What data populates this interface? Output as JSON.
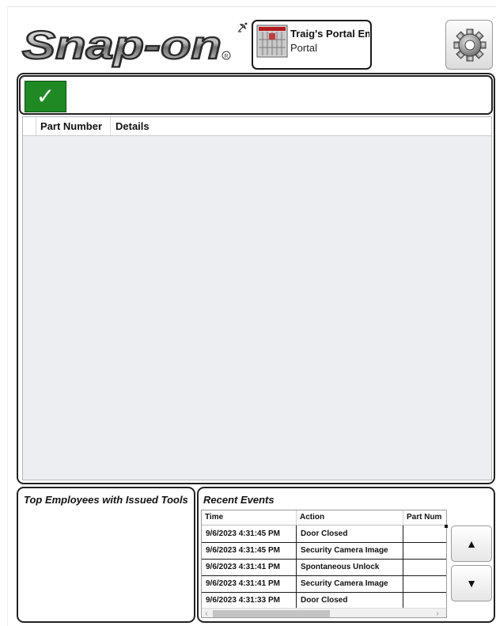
{
  "header": {
    "logo_text": "Snap-on",
    "portal_name": "Traig's Portal Em",
    "portal_subtitle": "Portal"
  },
  "main": {
    "confirm_icon": "checkmark-icon",
    "grid_columns": [
      "Part Number",
      "Details"
    ]
  },
  "employees_panel": {
    "title": "Top Employees with Issued Tools"
  },
  "events_panel": {
    "title": "Recent Events",
    "columns": [
      "Time",
      "Action",
      "Part Num"
    ],
    "rows": [
      {
        "time": "9/6/2023 4:31:45 PM",
        "action": "Door Closed",
        "part": ""
      },
      {
        "time": "9/6/2023 4:31:45 PM",
        "action": "Security Camera Image",
        "part": ""
      },
      {
        "time": "9/6/2023 4:31:41 PM",
        "action": "Spontaneous Unlock",
        "part": ""
      },
      {
        "time": "9/6/2023 4:31:41 PM",
        "action": "Security Camera Image",
        "part": ""
      },
      {
        "time": "9/6/2023 4:31:33 PM",
        "action": "Door Closed",
        "part": ""
      }
    ],
    "scroll_up_icon": "up-arrow-icon",
    "scroll_down_icon": "down-arrow-icon"
  },
  "colors": {
    "confirm_green": "#1f8a24",
    "panel_border": "#222222",
    "grid_background": "#eceef1"
  }
}
